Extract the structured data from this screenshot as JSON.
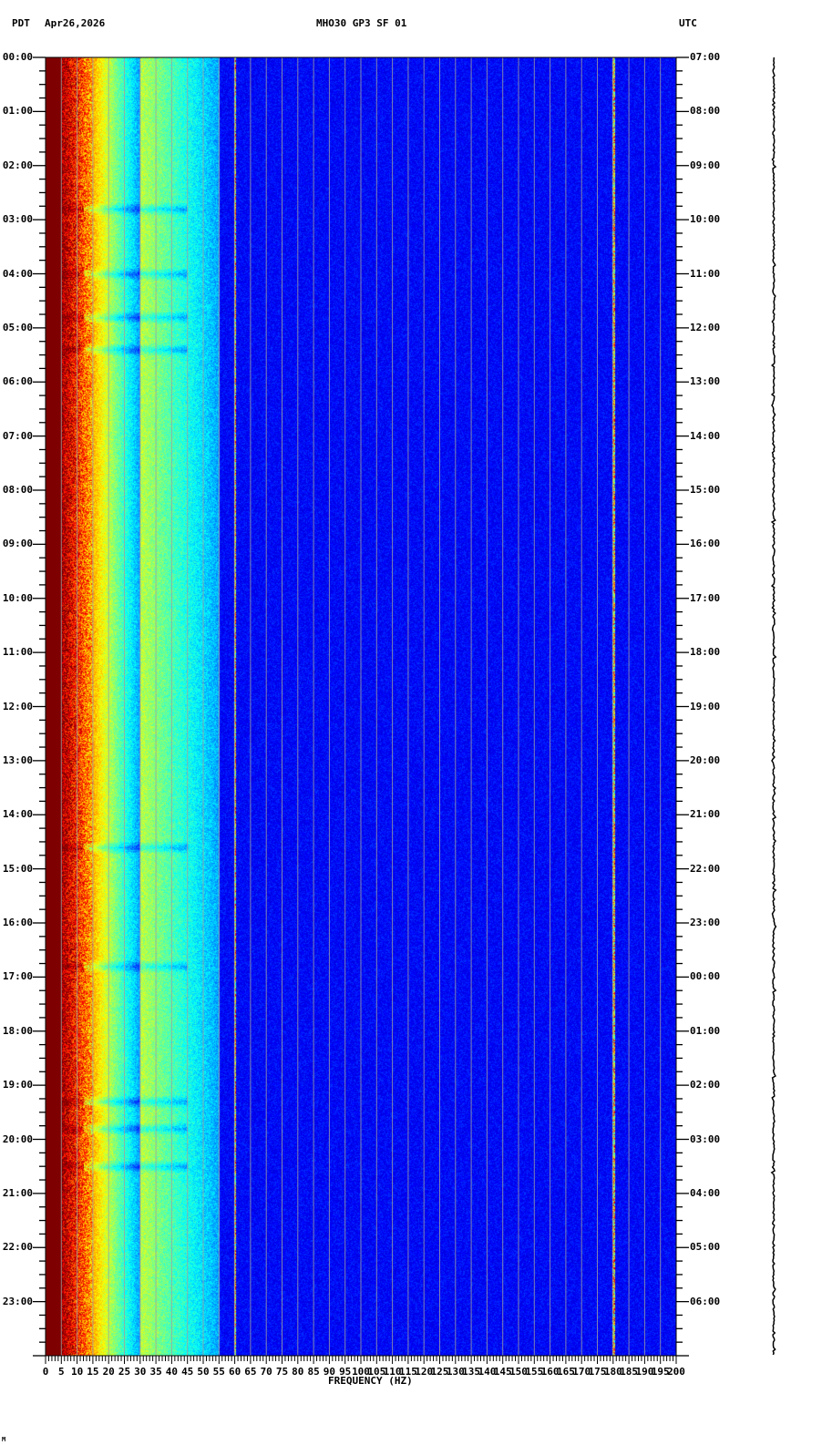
{
  "header": {
    "timezone_left": "PDT",
    "date": "Apr26,2026",
    "station": "MHO30 GP3 SF 01",
    "timezone_right": "UTC"
  },
  "corner_mark": "M",
  "chart_data": {
    "type": "heatmap",
    "subtype": "spectrogram",
    "title": "MHO30 GP3 SF 01",
    "xlabel": "FREQUENCY (HZ)",
    "ylabel_left": "PDT",
    "ylabel_right": "UTC",
    "xlim": [
      0,
      200
    ],
    "ylim_hours": [
      0,
      24
    ],
    "x_ticks": [
      "0",
      "5",
      "10",
      "15",
      "20",
      "25",
      "30",
      "35",
      "40",
      "45",
      "50",
      "55",
      "60",
      "65",
      "70",
      "75",
      "80",
      "85",
      "90",
      "95",
      "100",
      "105",
      "110",
      "115",
      "120",
      "125",
      "130",
      "135",
      "140",
      "145",
      "150",
      "155",
      "160",
      "165",
      "170",
      "175",
      "180",
      "185",
      "190",
      "195",
      "200"
    ],
    "y_ticks_left": [
      "00:00",
      "01:00",
      "02:00",
      "03:00",
      "04:00",
      "05:00",
      "06:00",
      "07:00",
      "08:00",
      "09:00",
      "10:00",
      "11:00",
      "12:00",
      "13:00",
      "14:00",
      "15:00",
      "16:00",
      "17:00",
      "18:00",
      "19:00",
      "20:00",
      "21:00",
      "22:00",
      "23:00"
    ],
    "y_ticks_right": [
      "07:00",
      "08:00",
      "09:00",
      "10:00",
      "11:00",
      "12:00",
      "13:00",
      "14:00",
      "15:00",
      "16:00",
      "17:00",
      "18:00",
      "19:00",
      "20:00",
      "21:00",
      "22:00",
      "23:00",
      "00:00",
      "01:00",
      "02:00",
      "03:00",
      "04:00",
      "05:00",
      "06:00"
    ],
    "spectral_lines_hz": [
      60,
      180
    ],
    "energy_profile": {
      "saturated_below_hz": 5,
      "red_yellow_to_hz": 15,
      "cyan_to_hz": 30,
      "blue_from_hz": 55
    },
    "event_hours_pdt": [
      2.8,
      4.0,
      4.8,
      5.4,
      14.6,
      16.8,
      19.3,
      19.8,
      20.5
    ],
    "grid_hz_step": 5,
    "colors": {
      "low": "#0000a8",
      "mid": "#00c8ff",
      "high": "#ffff00",
      "max": "#800000",
      "grid": "#a0a0a0"
    }
  }
}
